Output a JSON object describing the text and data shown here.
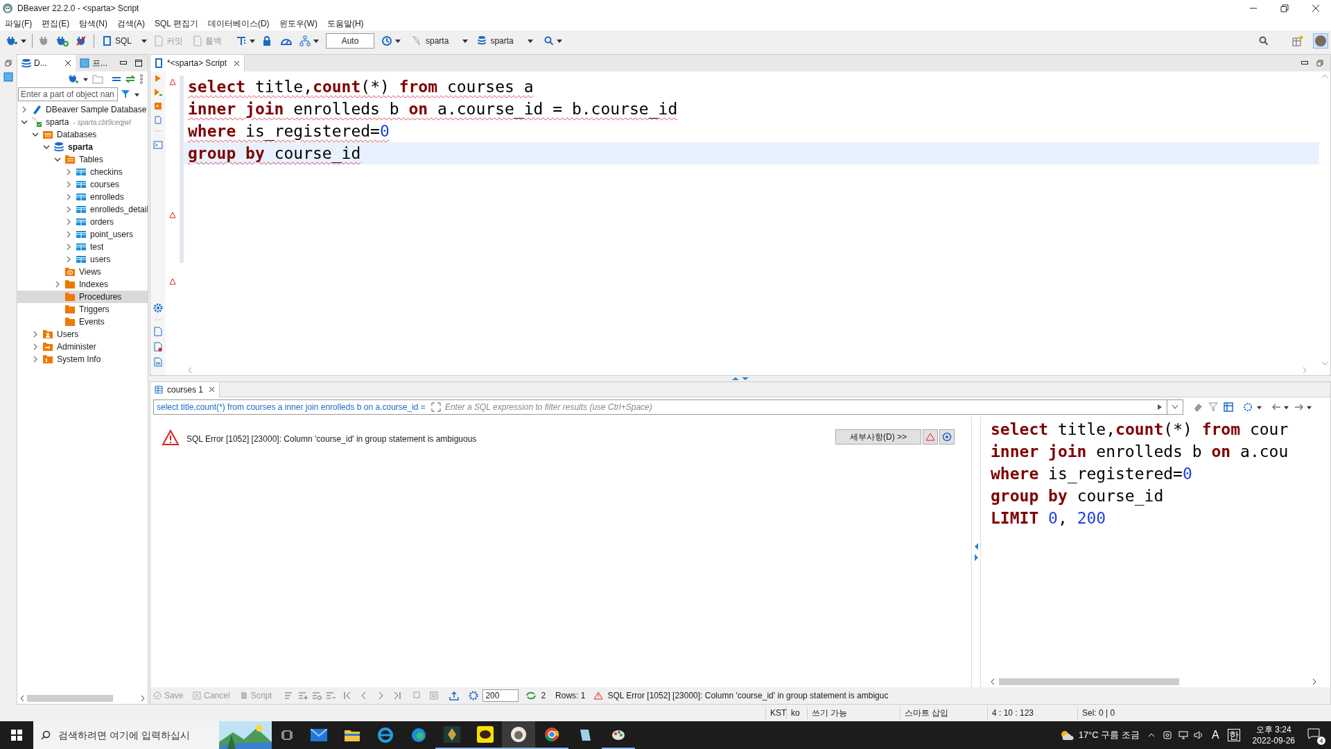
{
  "window": {
    "title": "DBeaver 22.2.0 - <sparta> Script"
  },
  "menu": [
    "파일(F)",
    "편집(E)",
    "탐색(N)",
    "검색(A)",
    "SQL 편집기",
    "데이터베이스(D)",
    "윈도우(W)",
    "도움말(H)"
  ],
  "toolbar": {
    "sql": {
      "label": "SQL",
      "disabled": false
    },
    "commit": {
      "label": "커밋",
      "disabled": true
    },
    "rollback": {
      "label": "롤백",
      "disabled": true
    },
    "transaction_mode": "Auto",
    "datasource": "sparta",
    "schema": "sparta"
  },
  "navigator": {
    "tabs": [
      {
        "label": "D...",
        "selected": true
      },
      {
        "label": "프...",
        "selected": false
      }
    ],
    "filter": {
      "placeholder": "Enter a part of object nan"
    },
    "tree": [
      {
        "label": "DBeaver Sample Database",
        "kind": "sample",
        "expandable": true,
        "expanded": false,
        "selected": false,
        "bold": false
      },
      {
        "label": "sparta",
        "detail": "- sparta.cbt9ceqjwl",
        "kind": "connection",
        "expandable": true,
        "expanded": true,
        "selected": false,
        "bold": false,
        "children": [
          {
            "label": "Databases",
            "kind": "databases",
            "expandable": true,
            "expanded": true,
            "selected": false,
            "bold": false,
            "children": [
              {
                "label": "sparta",
                "kind": "database",
                "expandable": true,
                "expanded": true,
                "selected": false,
                "bold": true,
                "children": [
                  {
                    "label": "Tables",
                    "kind": "tables",
                    "expandable": true,
                    "expanded": true,
                    "selected": false,
                    "bold": false,
                    "children": [
                      {
                        "label": "checkins",
                        "kind": "table",
                        "expandable": true,
                        "expanded": false,
                        "selected": false,
                        "bold": false
                      },
                      {
                        "label": "courses",
                        "kind": "table",
                        "expandable": true,
                        "expanded": false,
                        "selected": false,
                        "bold": false
                      },
                      {
                        "label": "enrolleds",
                        "kind": "table",
                        "expandable": true,
                        "expanded": false,
                        "selected": false,
                        "bold": false
                      },
                      {
                        "label": "enrolleds_detail",
                        "kind": "table",
                        "expandable": true,
                        "expanded": false,
                        "selected": false,
                        "bold": false
                      },
                      {
                        "label": "orders",
                        "kind": "table",
                        "expandable": true,
                        "expanded": false,
                        "selected": false,
                        "bold": false
                      },
                      {
                        "label": "point_users",
                        "kind": "table",
                        "expandable": true,
                        "expanded": false,
                        "selected": false,
                        "bold": false
                      },
                      {
                        "label": "test",
                        "kind": "table",
                        "expandable": true,
                        "expanded": false,
                        "selected": false,
                        "bold": false
                      },
                      {
                        "label": "users",
                        "kind": "table",
                        "expandable": true,
                        "expanded": false,
                        "selected": false,
                        "bold": false
                      }
                    ]
                  },
                  {
                    "label": "Views",
                    "kind": "views",
                    "expandable": false,
                    "expanded": false,
                    "selected": false,
                    "bold": false
                  },
                  {
                    "label": "Indexes",
                    "kind": "folder",
                    "expandable": true,
                    "expanded": false,
                    "selected": false,
                    "bold": false
                  },
                  {
                    "label": "Procedures",
                    "kind": "folder",
                    "expandable": false,
                    "expanded": false,
                    "selected": true,
                    "bold": false
                  },
                  {
                    "label": "Triggers",
                    "kind": "folder",
                    "expandable": false,
                    "expanded": false,
                    "selected": false,
                    "bold": false
                  },
                  {
                    "label": "Events",
                    "kind": "folder",
                    "expandable": false,
                    "expanded": false,
                    "selected": false,
                    "bold": false
                  }
                ]
              }
            ]
          },
          {
            "label": "Users",
            "kind": "users",
            "expandable": true,
            "expanded": false,
            "selected": false,
            "bold": false
          },
          {
            "label": "Administer",
            "kind": "admin",
            "expandable": true,
            "expanded": false,
            "selected": false,
            "bold": false
          },
          {
            "label": "System Info",
            "kind": "info",
            "expandable": true,
            "expanded": false,
            "selected": false,
            "bold": false
          }
        ]
      }
    ]
  },
  "editor": {
    "tab": {
      "label": "*<sparta> Script",
      "selected": true
    },
    "lines": [
      {
        "current": false,
        "tokens": [
          {
            "kind": "keyword",
            "text": "select"
          },
          {
            "kind": "text",
            "text": " title,"
          },
          {
            "kind": "keyword",
            "text": "count"
          },
          {
            "kind": "text",
            "text": "(*) "
          },
          {
            "kind": "keyword",
            "text": "from"
          },
          {
            "kind": "text",
            "text": " courses a"
          }
        ]
      },
      {
        "current": false,
        "tokens": [
          {
            "kind": "keyword",
            "text": "inner join"
          },
          {
            "kind": "text",
            "text": " enrolleds b "
          },
          {
            "kind": "keyword",
            "text": "on"
          },
          {
            "kind": "text",
            "text": " a.course_id = b.course_id"
          }
        ]
      },
      {
        "current": false,
        "tokens": [
          {
            "kind": "keyword",
            "text": "where"
          },
          {
            "kind": "text",
            "text": " is_registered="
          },
          {
            "kind": "number",
            "text": "0"
          }
        ]
      },
      {
        "current": true,
        "tokens": [
          {
            "kind": "keyword",
            "text": "group by"
          },
          {
            "kind": "text",
            "text": " course_id"
          }
        ]
      }
    ]
  },
  "results": {
    "tab": {
      "label": "courses 1",
      "selected": true
    },
    "query": "select title,count(*) from courses a inner join enrolleds b on a.course_id =",
    "filter": {
      "placeholder": "Enter a SQL expression to filter results (use Ctrl+Space)"
    },
    "error": "SQL Error [1052] [23000]: Column 'course_id' in group statement is ambiguous",
    "details_button": "세부사항(D) >>",
    "query_lines": [
      [
        {
          "kind": "keyword",
          "text": "select"
        },
        {
          "kind": "text",
          "text": " title,"
        },
        {
          "kind": "keyword",
          "text": "count"
        },
        {
          "kind": "text",
          "text": "(*) "
        },
        {
          "kind": "keyword",
          "text": "from"
        },
        {
          "kind": "text",
          "text": " cour"
        }
      ],
      [
        {
          "kind": "keyword",
          "text": "inner join"
        },
        {
          "kind": "text",
          "text": " enrolleds b "
        },
        {
          "kind": "keyword",
          "text": "on"
        },
        {
          "kind": "text",
          "text": " a.cou"
        }
      ],
      [
        {
          "kind": "keyword",
          "text": "where"
        },
        {
          "kind": "text",
          "text": " is_registered="
        },
        {
          "kind": "number",
          "text": "0"
        }
      ],
      [
        {
          "kind": "keyword",
          "text": "group by"
        },
        {
          "kind": "text",
          "text": " course_id"
        }
      ],
      [
        {
          "kind": "keyword",
          "text": "LIMIT "
        },
        {
          "kind": "number",
          "text": "0"
        },
        {
          "kind": "text",
          "text": ", "
        },
        {
          "kind": "number",
          "text": "200"
        }
      ]
    ]
  },
  "results_toolbar": {
    "save": "Save",
    "cancel": "Cancel",
    "script": "Script",
    "fetch_size": "200",
    "refresh_count": "2",
    "rows": "Rows: 1",
    "message": "SQL Error [1052] [23000]: Column 'course_id' in group statement is ambiguc"
  },
  "status_bar": [
    "KST",
    "ko",
    "쓰기 가능",
    "스마트 삽입",
    "4 : 10 : 123",
    "Sel: 0 | 0"
  ],
  "taskbar": {
    "search": {
      "placeholder": "검색하려면 여기에 입력하십시"
    },
    "weather": "17°C 구름 조금",
    "ime_mode": "A",
    "ime_lang": "한",
    "time": "오후 3:24",
    "date": "2022-09-26",
    "notifications": "4"
  }
}
